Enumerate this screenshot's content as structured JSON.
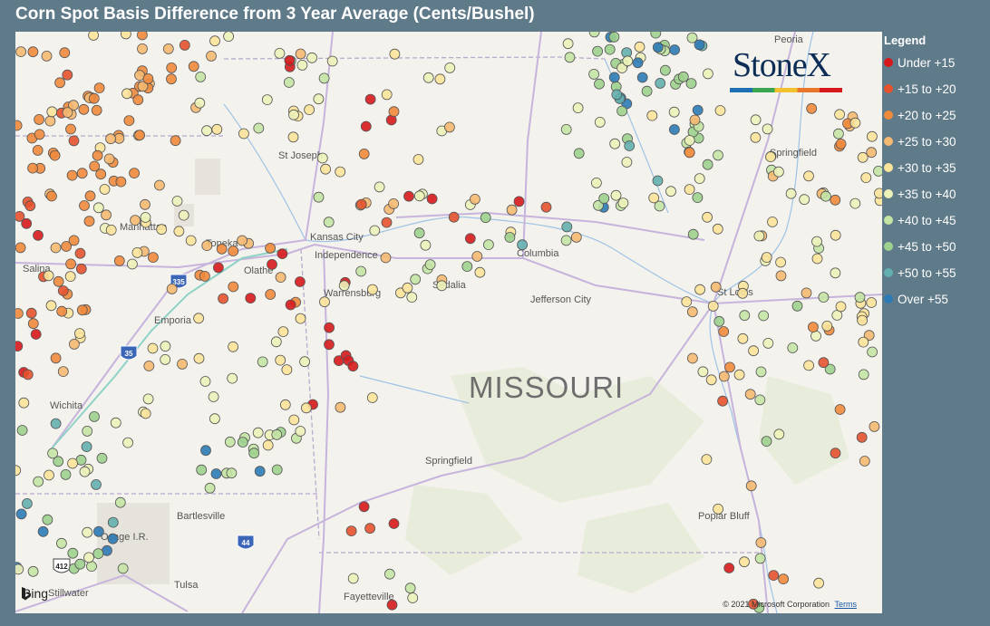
{
  "title": "Corn Spot Basis Difference from 3 Year Average (Cents/Bushel)",
  "legend": {
    "title": "Legend",
    "items": [
      {
        "label": "Under +15",
        "color": "#d7191c"
      },
      {
        "label": "+15 to +20",
        "color": "#e4522e"
      },
      {
        "label": "+20 to +25",
        "color": "#ef8a3c"
      },
      {
        "label": "+25 to +30",
        "color": "#f5b971"
      },
      {
        "label": "+30 to +35",
        "color": "#fbe39a"
      },
      {
        "label": "+35 to +40",
        "color": "#edf2b8"
      },
      {
        "label": "+40 to +45",
        "color": "#c4e4a4"
      },
      {
        "label": "+45 to +50",
        "color": "#9fd18e"
      },
      {
        "label": "+50 to +55",
        "color": "#64b0ae"
      },
      {
        "label": "Over +55",
        "color": "#2c7bb6"
      }
    ]
  },
  "map": {
    "state_label": "MISSOURI",
    "cities": [
      "St Joseph",
      "Manhattan",
      "Topeka",
      "Kansas City",
      "Independence",
      "Olathe",
      "Columbia",
      "Salina",
      "Sedalia",
      "Warrensburg",
      "Jefferson City",
      "St Louis",
      "Emporia",
      "Wichita",
      "Springfield",
      "Springfield",
      "Bartlesville",
      "Osage I.R.",
      "Tulsa",
      "Stillwater",
      "Fayetteville",
      "Poplar Bluff",
      "Peoria"
    ],
    "road_shields": [
      "335",
      "35",
      "44",
      "412"
    ]
  },
  "logo": {
    "text": "StoneX",
    "colors": [
      "#1f6fb5",
      "#3aa651",
      "#f2c12e",
      "#e8772c",
      "#d7191c"
    ]
  },
  "attribution": {
    "bing": "Bing",
    "copyright": "© 2021 Microsoft Corporation",
    "terms": "Terms"
  }
}
